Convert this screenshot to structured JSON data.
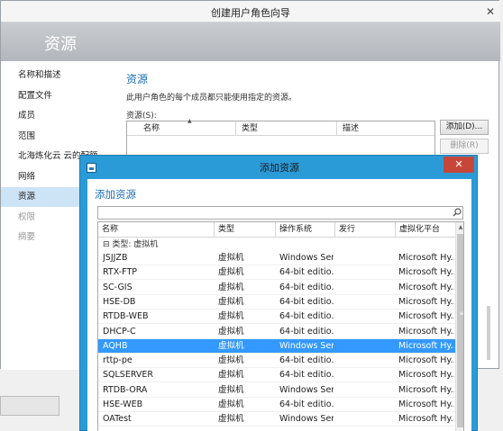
{
  "wizard": {
    "title": "创建用户角色向导",
    "close": "✕",
    "header": "资源",
    "nav": [
      {
        "label": "名称和描述",
        "state": "normal"
      },
      {
        "label": "配置文件",
        "state": "normal"
      },
      {
        "label": "成员",
        "state": "normal"
      },
      {
        "label": "范围",
        "state": "normal"
      },
      {
        "label": "北海炼化云 云的配额",
        "state": "normal"
      },
      {
        "label": "网络",
        "state": "normal"
      },
      {
        "label": "资源",
        "state": "selected"
      },
      {
        "label": "权限",
        "state": "disabled"
      },
      {
        "label": "摘要",
        "state": "disabled"
      }
    ],
    "main_title": "资源",
    "description": "此用户角色的每个成员都只能使用指定的资源。",
    "resources_label": "资源(S):",
    "columns": [
      "名称",
      "类型",
      "描述"
    ],
    "add_button": "添加(D)...",
    "delete_button": "删除(R)"
  },
  "dialog": {
    "title": "添加资源",
    "close": "✕",
    "heading": "添加资源",
    "search": {
      "value": "",
      "placeholder": ""
    },
    "search_icon": "search-icon",
    "columns": [
      "名称",
      "类型",
      "操作系统",
      "发行",
      "虚拟化平台"
    ],
    "group": "⊟ 类型: 虚拟机",
    "rows": [
      {
        "name": "JSJJZB",
        "type": "虚拟机",
        "os": "Windows Ser...",
        "release": "",
        "platform": "Microsoft Hy..."
      },
      {
        "name": "RTX-FTP",
        "type": "虚拟机",
        "os": "64-bit editio...",
        "release": "",
        "platform": "Microsoft Hy..."
      },
      {
        "name": "SC-GIS",
        "type": "虚拟机",
        "os": "64-bit editio...",
        "release": "",
        "platform": "Microsoft Hy..."
      },
      {
        "name": "HSE-DB",
        "type": "虚拟机",
        "os": "64-bit editio...",
        "release": "",
        "platform": "Microsoft Hy..."
      },
      {
        "name": "RTDB-WEB",
        "type": "虚拟机",
        "os": "64-bit editio...",
        "release": "",
        "platform": "Microsoft Hy..."
      },
      {
        "name": "DHCP-C",
        "type": "虚拟机",
        "os": "64-bit editio...",
        "release": "",
        "platform": "Microsoft Hy..."
      },
      {
        "name": "AQHB",
        "type": "虚拟机",
        "os": "Windows Ser...",
        "release": "",
        "platform": "Microsoft Hy...",
        "selected": true
      },
      {
        "name": "rttp-pe",
        "type": "虚拟机",
        "os": "64-bit editio...",
        "release": "",
        "platform": "Microsoft Hy..."
      },
      {
        "name": "SQLSERVER",
        "type": "虚拟机",
        "os": "64-bit editio...",
        "release": "",
        "platform": "Microsoft Hy..."
      },
      {
        "name": "RTDB-ORA",
        "type": "虚拟机",
        "os": "Windows Ser...",
        "release": "",
        "platform": "Microsoft Hy..."
      },
      {
        "name": "HSE-WEB",
        "type": "虚拟机",
        "os": "64-bit editio...",
        "release": "",
        "platform": "Microsoft Hy..."
      },
      {
        "name": "OATest",
        "type": "虚拟机",
        "os": "Windows Ser...",
        "release": "",
        "platform": "Microsoft Hy..."
      }
    ],
    "selected_row": "AQHB"
  },
  "colors": {
    "accent": "#2b9bd8",
    "selection": "#3399ff",
    "heading": "#1e6fb5",
    "close": "#c7463a"
  }
}
